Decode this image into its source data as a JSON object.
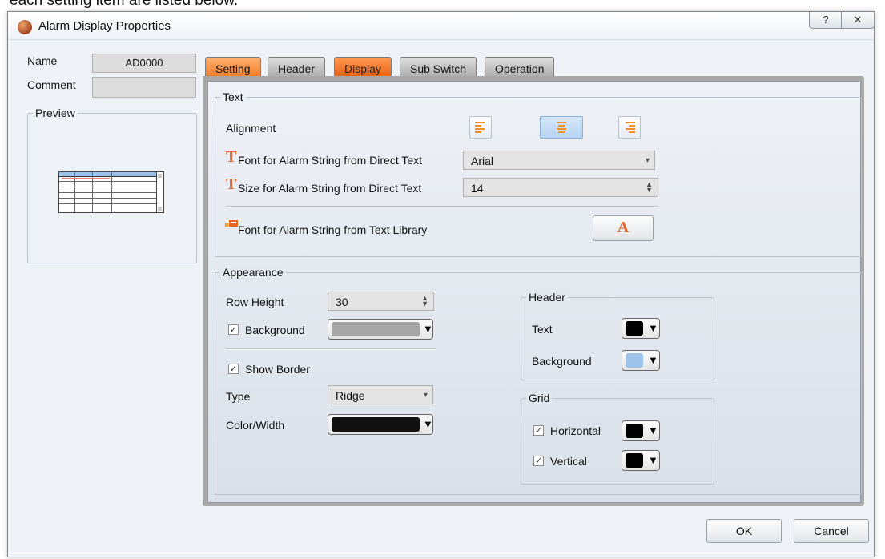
{
  "doc_caption": "each setting item are listed below.",
  "window": {
    "title": "Alarm Display Properties",
    "help_glyph": "?",
    "close_glyph": "✕"
  },
  "left": {
    "name_label": "Name",
    "name_value": "AD0000",
    "comment_label": "Comment",
    "comment_value": "",
    "preview_label": "Preview"
  },
  "tabs": [
    {
      "label": "Setting"
    },
    {
      "label": "Header"
    },
    {
      "label": "Display"
    },
    {
      "label": "Sub Switch"
    },
    {
      "label": "Operation"
    }
  ],
  "active_tab": "Display",
  "text_group": {
    "title": "Text",
    "alignment_label": "Alignment",
    "alignment_selected": "center",
    "font_direct_label": "Font for Alarm String from Direct Text",
    "font_direct_value": "Arial",
    "size_direct_label": "Size for Alarm String from Direct Text",
    "size_direct_value": "14",
    "font_library_label": "Font for Alarm String from Text Library",
    "font_library_button": "A"
  },
  "appearance": {
    "title": "Appearance",
    "row_height_label": "Row Height",
    "row_height_value": "30",
    "background_label": "Background",
    "background_checked": true,
    "background_color": "#a6a6a6",
    "show_border_label": "Show Border",
    "show_border_checked": true,
    "type_label": "Type",
    "type_value": "Ridge",
    "color_width_label": "Color/Width",
    "color_width_color": "#111111",
    "header": {
      "title": "Header",
      "text_label": "Text",
      "text_color": "#000000",
      "background_label": "Background",
      "background_color": "#9ec3ea"
    },
    "grid": {
      "title": "Grid",
      "horizontal_label": "Horizontal",
      "horizontal_checked": true,
      "horizontal_color": "#000000",
      "vertical_label": "Vertical",
      "vertical_checked": true,
      "vertical_color": "#000000"
    }
  },
  "buttons": {
    "ok": "OK",
    "cancel": "Cancel"
  },
  "colors": {
    "active_tab": "#f26d1b",
    "tab_inactive": "#b9b9b9"
  }
}
